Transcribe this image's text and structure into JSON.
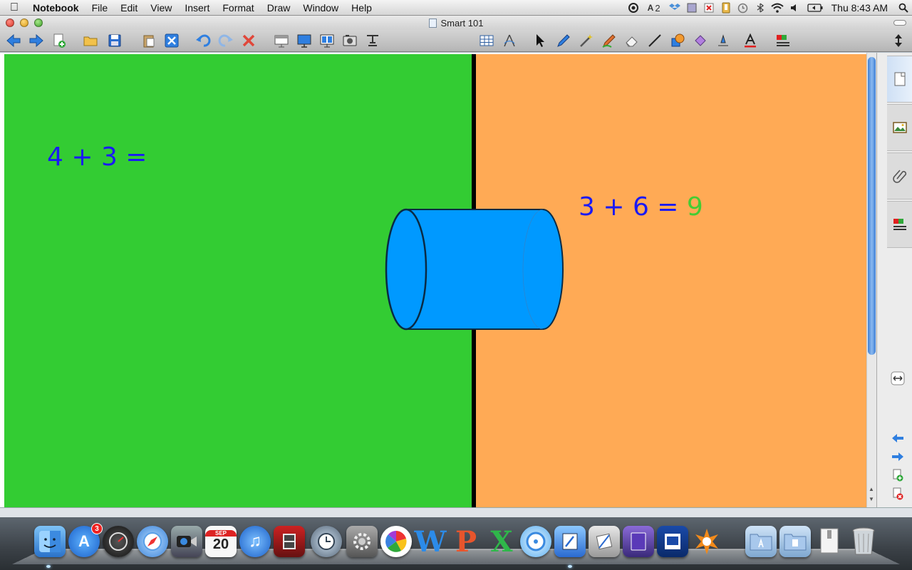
{
  "menubar": {
    "app_name": "Notebook",
    "items": [
      "File",
      "Edit",
      "View",
      "Insert",
      "Format",
      "Draw",
      "Window",
      "Help"
    ],
    "status_badge_count": "2",
    "clock": "Thu 8:43 AM"
  },
  "window": {
    "title": "Smart 101"
  },
  "canvas": {
    "left_equation": "4 + 3 =",
    "right_equation": "3 + 6 =",
    "right_answer": "9",
    "colors": {
      "left_panel": "#33cc33",
      "right_panel": "#ffaa55",
      "divider": "#000000",
      "equation_text": "#1a1af5",
      "answer_text": "#44cc33",
      "tube_fill": "#0099ff",
      "tube_stroke": "#0a2a44"
    }
  },
  "dock": {
    "calendar_day": "20",
    "calendar_month": "SEP",
    "app_store_badge": "3"
  }
}
